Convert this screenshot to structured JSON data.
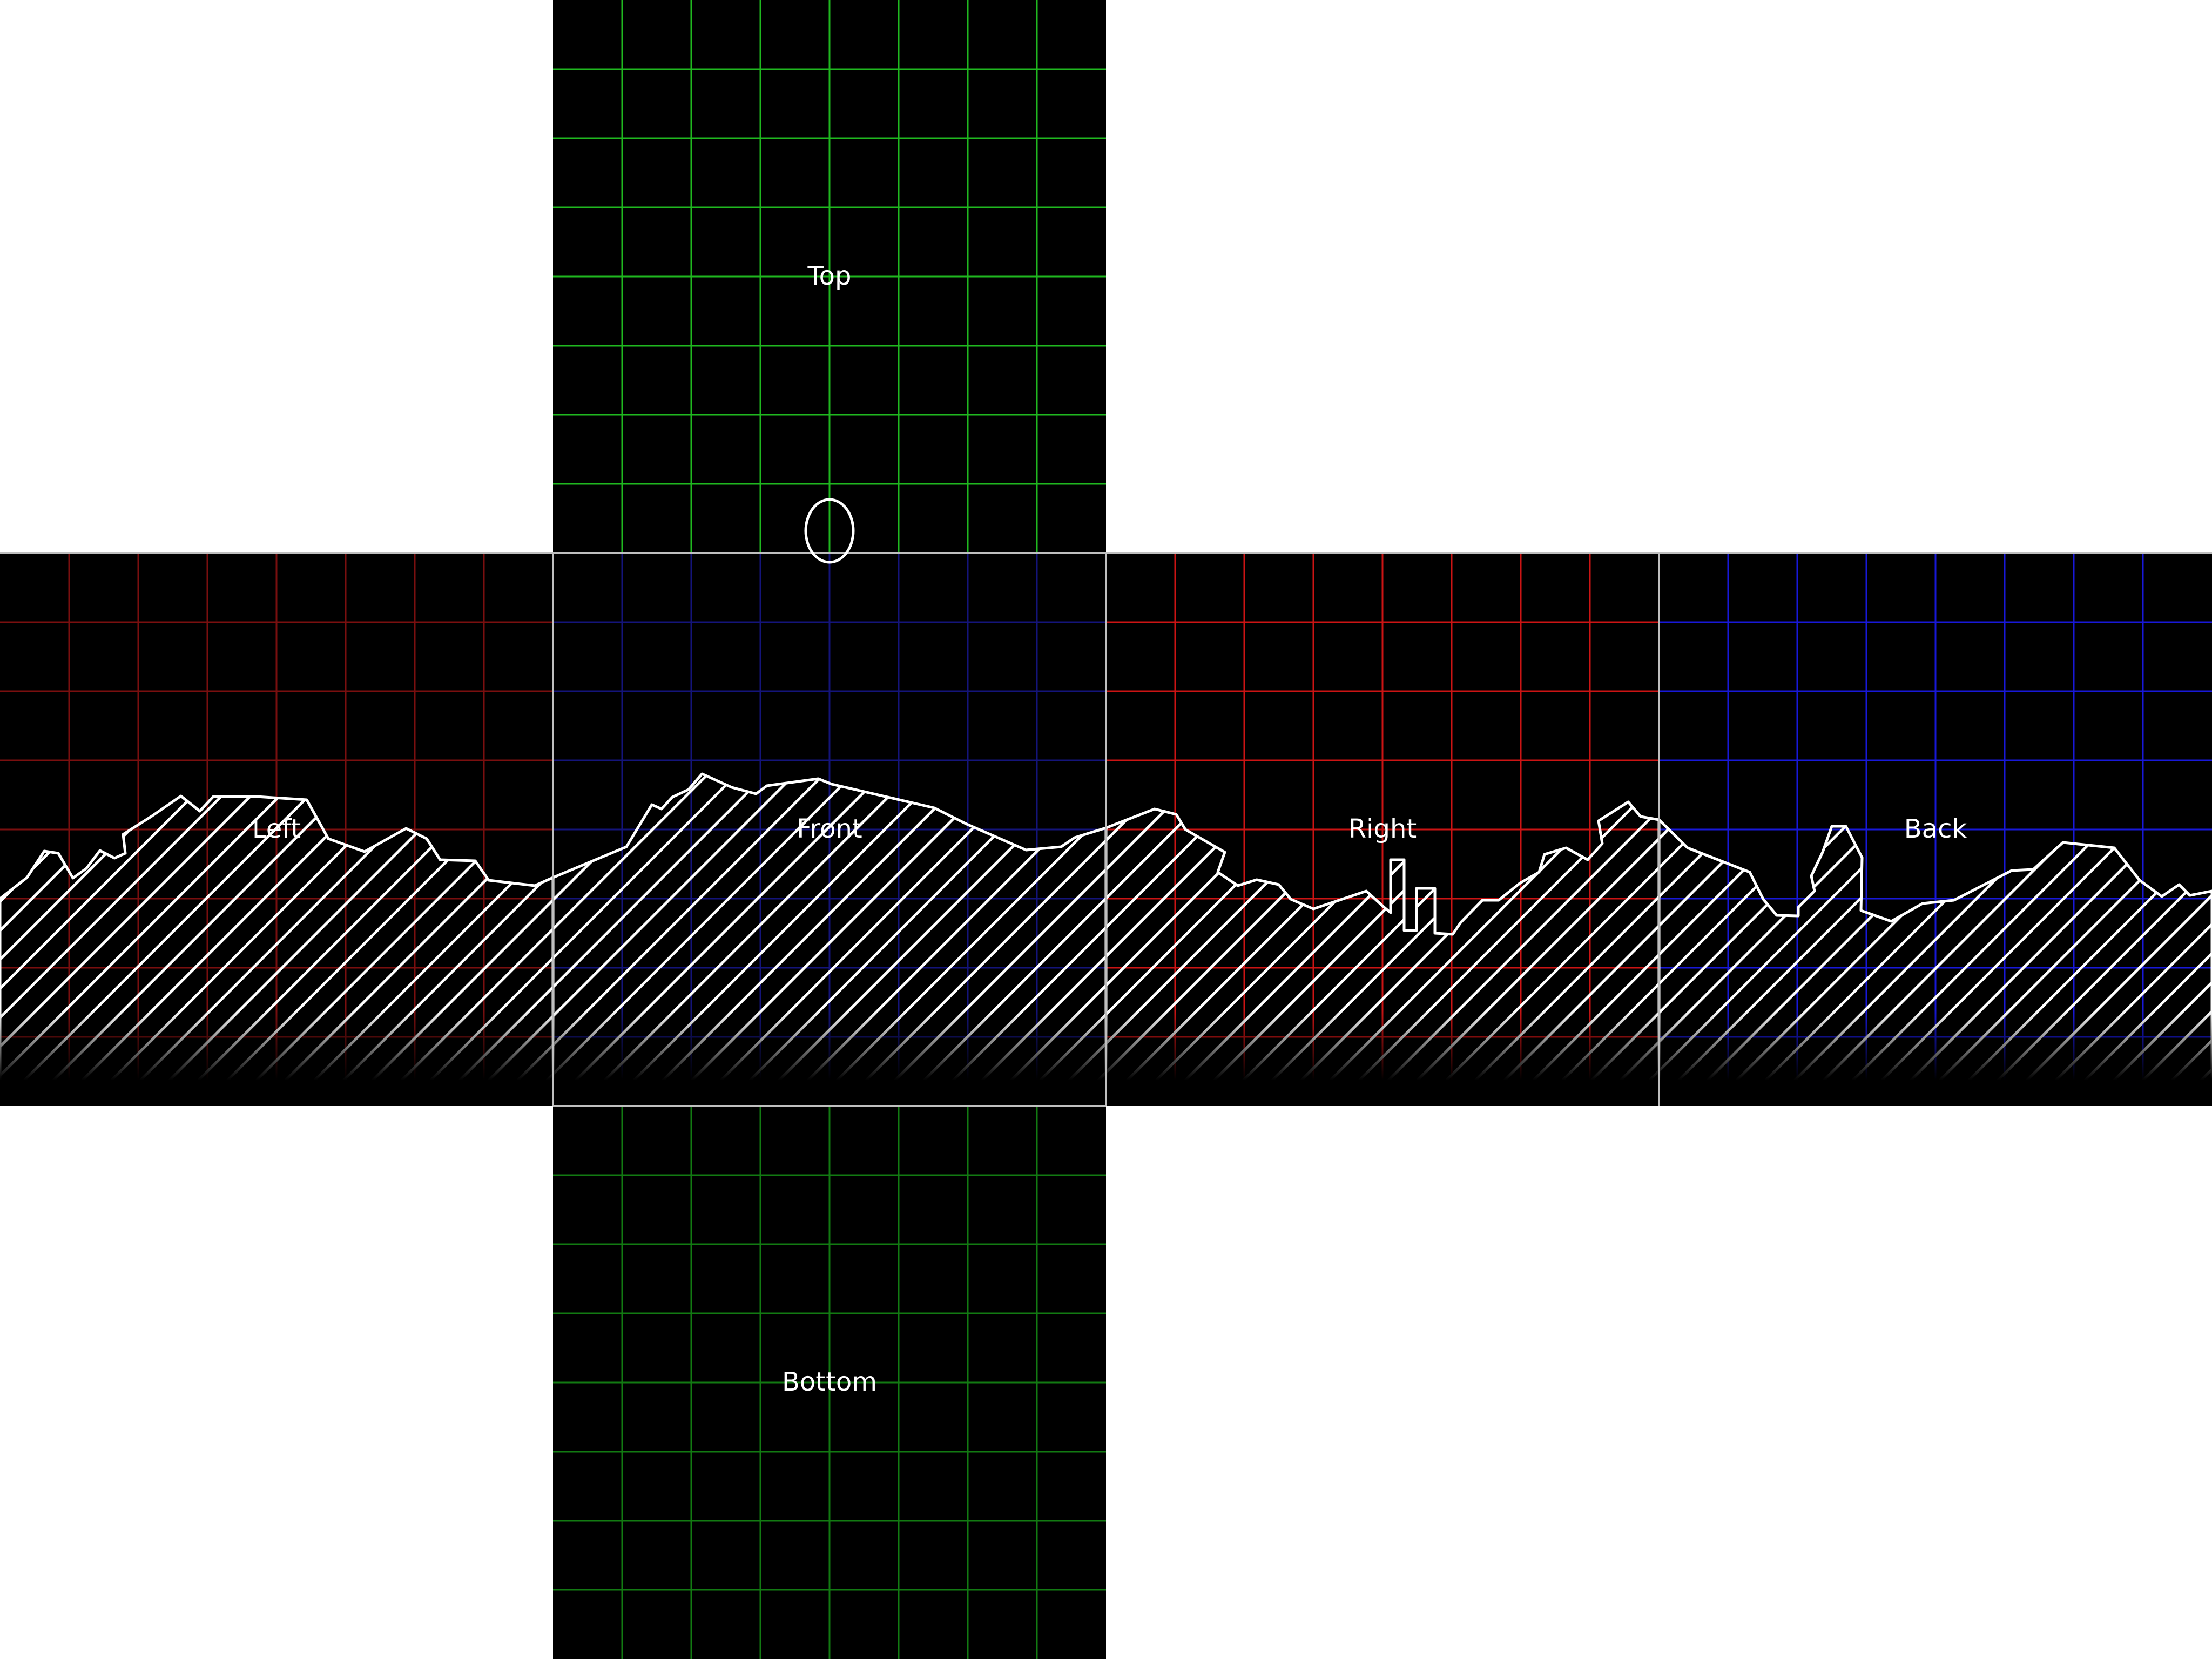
{
  "faces": {
    "top": {
      "label": "Top",
      "grid_color": "#1fb81f"
    },
    "left": {
      "label": "Left",
      "grid_color": "#7a0f0f"
    },
    "front": {
      "label": "Front",
      "grid_color": "#14147a"
    },
    "right": {
      "label": "Right",
      "grid_color": "#cc1414"
    },
    "back": {
      "label": "Back",
      "grid_color": "#1818d8"
    },
    "bottom": {
      "label": "Bottom",
      "grid_color": "#127a12"
    }
  },
  "colors": {
    "background": "#ffffff",
    "face_fill": "#000000",
    "seam": "#bfbfbf",
    "terrain_outline": "#ffffff"
  },
  "marker": {
    "description_icon": "ellipse-marker-icon"
  }
}
